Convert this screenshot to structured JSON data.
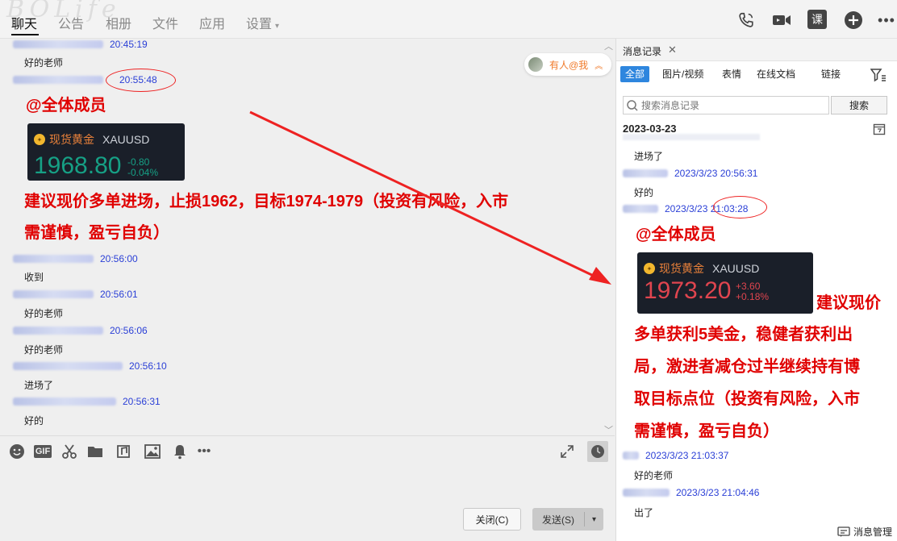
{
  "topbar": {
    "tabs": [
      "聊天",
      "公告",
      "相册",
      "文件",
      "应用",
      "设置"
    ],
    "right_icons": [
      "phone-icon",
      "video-icon",
      "lesson-icon",
      "plus-icon",
      "more-icon"
    ],
    "lesson_label": "课"
  },
  "chat": {
    "messages": [
      {
        "time": "20:45:19",
        "text": "好的老师"
      },
      {
        "time": "20:55:48"
      },
      {
        "time": "20:56:00",
        "text": "收到"
      },
      {
        "time": "20:56:01",
        "text": "好的老师"
      },
      {
        "time": "20:56:06",
        "text": "好的老师"
      },
      {
        "time": "20:56:10",
        "text": "进场了"
      },
      {
        "time": "20:56:31",
        "text": "好的"
      }
    ],
    "mention_all": "@全体成员",
    "gold_card": {
      "title": "现货黄金",
      "symbol": "XAUUSD",
      "price": "1968.80",
      "change": "-0.80",
      "change_pct": "-0.04%",
      "color": "#16a085"
    },
    "advice_line1": "建议现价多单进场，止损1962，目标1974-1979（投资有风险，入市",
    "advice_line2": "需谨慎，盈亏自负）",
    "mention_pill": "有人@我"
  },
  "input_toolbar": {
    "icons": [
      "emoji-icon",
      "gif-icon",
      "scissors-icon",
      "folder-icon",
      "music-icon",
      "image-icon",
      "bell-icon",
      "more-icon"
    ],
    "gif_label": "GIF",
    "close_label": "关闭(C)",
    "send_label": "发送(S)"
  },
  "history": {
    "title": "消息记录",
    "filters": [
      "全部",
      "图片/视频",
      "表情",
      "在线文档",
      "链接"
    ],
    "search_placeholder": "搜索消息记录",
    "search_button": "搜索",
    "date": "2023-03-23",
    "messages": [
      {
        "text": "进场了"
      },
      {
        "time": "2023/3/23 20:56:31",
        "text": "好的"
      },
      {
        "time": "2023/3/23 21:03:28"
      },
      {
        "time": "2023/3/23 21:03:37",
        "text": "好的老师"
      },
      {
        "time": "2023/3/23 21:04:46",
        "text": "出了"
      }
    ],
    "mention_all": "@全体成员",
    "gold_card": {
      "title": "现货黄金",
      "symbol": "XAUUSD",
      "price": "1973.20",
      "change": "+3.60",
      "change_pct": "+0.18%",
      "color": "#e0454f"
    },
    "advice_lines": [
      "建议现价",
      "多单获利5美金，稳健者获利出",
      "局，激进者减仓过半继续持有博",
      "取目标点位（投资有风险，入市",
      "需谨慎，盈亏自负）"
    ],
    "manage_label": "消息管理"
  },
  "colors": {
    "annotation_red": "#e00000",
    "time_blue": "#2a3fd6",
    "accent_blue": "#2e86de"
  }
}
